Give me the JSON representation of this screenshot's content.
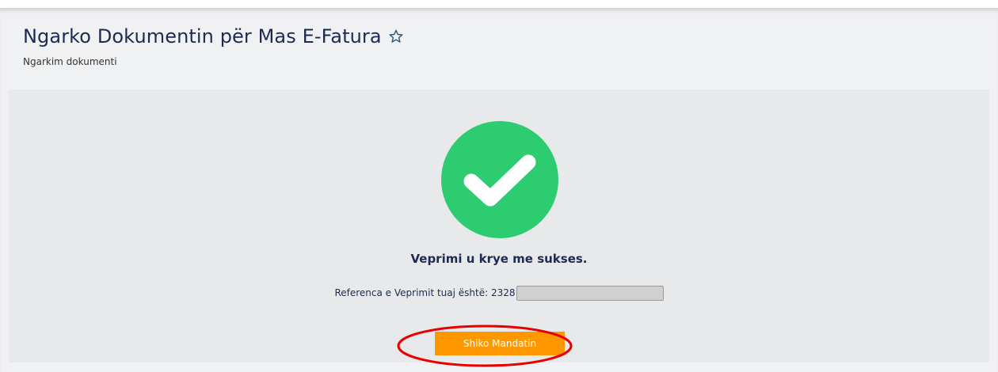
{
  "header": {
    "title": "Ngarko Dokumentin për Mas E-Fatura",
    "star_icon": "star-outline-icon",
    "subtitle": "Ngarkim dokumenti"
  },
  "result": {
    "status_icon": "check-circle-icon",
    "message": "Veprimi u krye me sukses.",
    "reference_label": "Referenca e Veprimit tuaj është:",
    "reference_value": "2328",
    "button_label": "Shiko Mandatin"
  },
  "colors": {
    "title": "#1d2a52",
    "success": "#2ecc71",
    "button": "#ff9800",
    "highlight_ring": "#e60000",
    "panel_bg": "#e8e9ea",
    "page_bg": "#f0f1f2"
  }
}
